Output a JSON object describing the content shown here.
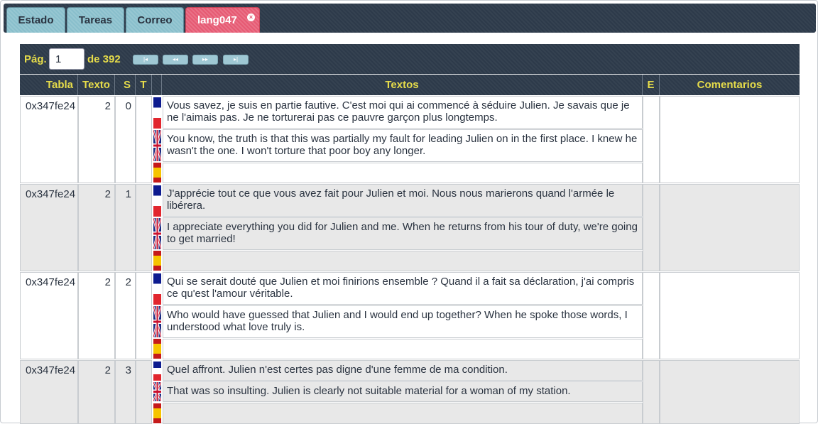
{
  "tabs": [
    {
      "label": "Estado",
      "active": false
    },
    {
      "label": "Tareas",
      "active": false
    },
    {
      "label": "Correo",
      "active": false
    },
    {
      "label": "lang047",
      "active": true
    }
  ],
  "pager": {
    "page_label": "Pág.",
    "page_value": "1",
    "of_label": "de 392",
    "first": "|◂",
    "prev": "◂◂",
    "next": "▸▸",
    "last": "▸|"
  },
  "columns": {
    "tabla": "Tabla",
    "texto": "Texto",
    "s": "S",
    "t": "T",
    "textos": "Textos",
    "e": "E",
    "comentarios": "Comentarios"
  },
  "colors": {
    "header_bg": "#2d3a4a",
    "header_text": "#e6dc4a",
    "tab_bg": "#89bfcc",
    "tab_active_bg": "#e65a73",
    "t_column": "#86b5e0",
    "e_column": "#e46a6a"
  },
  "rows": [
    {
      "tabla": "0x347fe24",
      "texto": "2",
      "s": "0",
      "fr": "Vous savez, je suis en partie fautive. C'est moi qui ai commencé à séduire Julien. Je savais que je ne l'aimais pas. Je ne torturerai pas ce pauvre garçon plus longtemps.",
      "en": "You know, the truth is that this was partially my fault for leading Julien on in the first place. I knew he wasn't the one. I won't torture that poor boy any longer.",
      "es": "",
      "comentarios": ""
    },
    {
      "tabla": "0x347fe24",
      "texto": "2",
      "s": "1",
      "fr": "J'apprécie tout ce que vous avez fait pour Julien et moi. Nous nous marierons quand l'armée le libérera.",
      "en": "I appreciate everything you did for Julien and me. When he returns from his tour of duty, we're going to get married!",
      "es": "",
      "comentarios": ""
    },
    {
      "tabla": "0x347fe24",
      "texto": "2",
      "s": "2",
      "fr": "Qui se serait douté que Julien et moi finirions ensemble ? Quand il a fait sa déclaration, j'ai compris ce qu'est l'amour véritable.",
      "en": "Who would have guessed that Julien and I would end up together? When he spoke those words, I understood what love truly is.",
      "es": "",
      "comentarios": ""
    },
    {
      "tabla": "0x347fe24",
      "texto": "2",
      "s": "3",
      "fr": "Quel affront. Julien n'est certes pas digne d'une femme de ma condition.",
      "en": "That was so insulting. Julien is clearly not suitable material for a woman of my station.",
      "es": "",
      "comentarios": ""
    }
  ]
}
